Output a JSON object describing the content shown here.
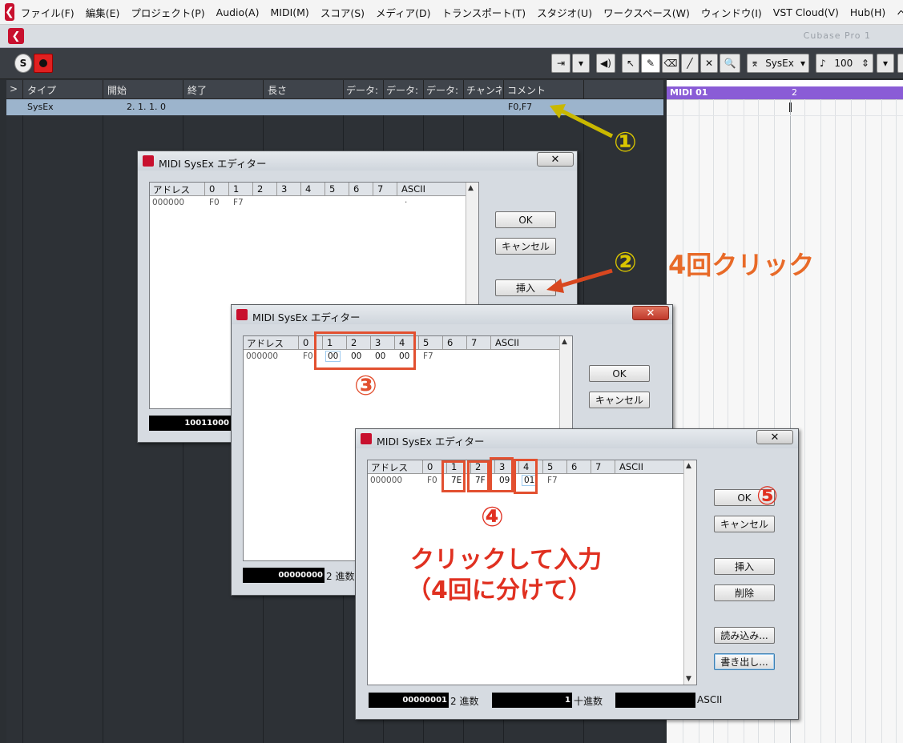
{
  "menubar": {
    "items": [
      "ファイル(F)",
      "編集(E)",
      "プロジェクト(P)",
      "Audio(A)",
      "MIDI(M)",
      "スコア(S)",
      "メディア(D)",
      "トランスポート(T)",
      "スタジオ(U)",
      "ワークスペース(W)",
      "ウィンドウ(I)",
      "VST Cloud(V)",
      "Hub(H)",
      "ヘル"
    ]
  },
  "titlestrip": {
    "blurred_title": "Cubase Pro 1"
  },
  "toolbar": {
    "solo_label": "S",
    "sysex_filter_label": "SysEx",
    "value_label": "100"
  },
  "list": {
    "columns": [
      "タイプ",
      "開始",
      "終了",
      "長さ",
      "データ:",
      "データ:",
      "データ:",
      "チャンネ",
      "コメント"
    ],
    "expand_glyph": ">",
    "row": {
      "type": "SysEx",
      "start": "2. 1. 1.   0",
      "comment": "F0,F7"
    }
  },
  "timeline": {
    "part_label": "MIDI 01",
    "bar_number": "2"
  },
  "dialog_title": "MIDI SysEx エディター",
  "dialog_columns": [
    "アドレス",
    "0",
    "1",
    "2",
    "3",
    "4",
    "5",
    "6",
    "7",
    "ASCII"
  ],
  "dialog1": {
    "address": "000000",
    "values": [
      "F0",
      "F7"
    ],
    "ascii": "·",
    "buttons": {
      "ok": "OK",
      "cancel": "キャンセル",
      "insert": "挿入"
    },
    "status_binary": "10011000"
  },
  "dialog2": {
    "address": "000000",
    "values": [
      "F0",
      "00",
      "00",
      "00",
      "00",
      "F7"
    ],
    "buttons": {
      "ok": "OK",
      "cancel": "キャンセル"
    },
    "status_binary": "00000000",
    "status_label": "2 進数"
  },
  "dialog3": {
    "address": "000000",
    "values": [
      "F0",
      "7E",
      "7F",
      "09",
      "01",
      "F7"
    ],
    "buttons": {
      "ok": "OK",
      "cancel": "キャンセル",
      "insert": "挿入",
      "delete": "削除",
      "import": "読み込み...",
      "export": "書き出し..."
    },
    "status_binary": "00000001",
    "status_binary_label": "2 進数",
    "status_decimal": "1",
    "status_decimal_label": "十進数",
    "status_ascii": "",
    "status_ascii_label": "ASCII"
  },
  "annotations": {
    "step1": "①",
    "step2": "②",
    "step2_text": "4回クリック",
    "step3": "③",
    "step4": "④",
    "step4_line1": "クリックして入力",
    "step4_line2": "（4回に分けて）",
    "step5": "⑤"
  },
  "colors": {
    "accent_red": "#c8102e",
    "annotation_orange": "#e25030",
    "annotation_yellow": "#d8c400",
    "annotation_text_red": "#e03020",
    "part_purple": "#8a5cd6"
  }
}
